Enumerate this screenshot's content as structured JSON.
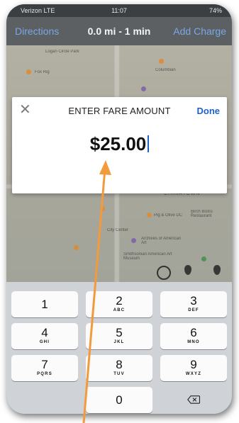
{
  "status_bar": {
    "carrier": "Verizon LTE",
    "time": "11:07",
    "battery": "74%"
  },
  "nav": {
    "left_link": "Directions",
    "summary": "0.0 mi - 1 min",
    "right_link": "Add Charge"
  },
  "map": {
    "labels": [
      "Logan Circle Park",
      "Columbian",
      "Fox Rig",
      "Chinatown",
      "Archives of American Art",
      "Smithsonian American Art Museum",
      "Pig & Olive DC",
      "City Center",
      "Birch Bistro Restaurant"
    ]
  },
  "dialog": {
    "close_icon": "close-icon",
    "title": "ENTER FARE AMOUNT",
    "done_label": "Done",
    "amount": "$25.00"
  },
  "keypad": {
    "keys": [
      {
        "num": "1",
        "letters": ""
      },
      {
        "num": "2",
        "letters": "ABC"
      },
      {
        "num": "3",
        "letters": "DEF"
      },
      {
        "num": "4",
        "letters": "GHI"
      },
      {
        "num": "5",
        "letters": "JKL"
      },
      {
        "num": "6",
        "letters": "MNO"
      },
      {
        "num": "7",
        "letters": "PQRS"
      },
      {
        "num": "8",
        "letters": "TUV"
      },
      {
        "num": "9",
        "letters": "WXYZ"
      },
      {
        "num": "0",
        "letters": ""
      }
    ],
    "delete_icon": "backspace-icon"
  },
  "colors": {
    "accent_blue": "#1f63c7",
    "nav_link_blue": "#7aa7e6",
    "annotation_orange": "#f39a3d"
  }
}
